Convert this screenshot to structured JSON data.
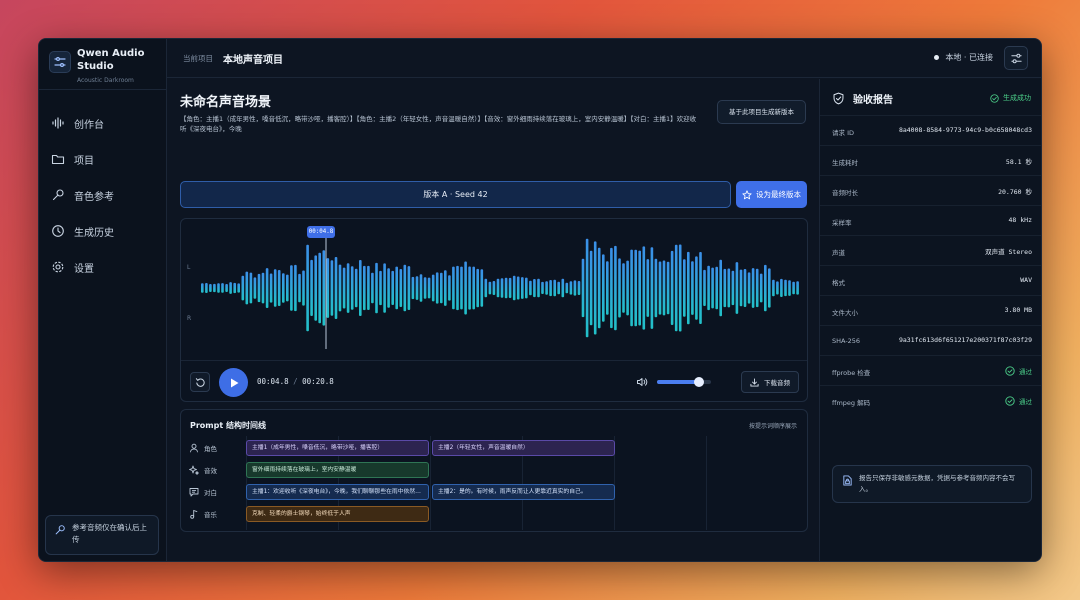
{
  "brand": {
    "name": "Qwen Audio Studio",
    "subtitle": "Acoustic Darkroom"
  },
  "nav": [
    {
      "label": "创作台",
      "icon": "waveform-icon"
    },
    {
      "label": "项目",
      "icon": "folder-icon"
    },
    {
      "label": "音色参考",
      "icon": "microphone-icon"
    },
    {
      "label": "生成历史",
      "icon": "clock-icon"
    },
    {
      "label": "设置",
      "icon": "gear-icon"
    }
  ],
  "sidebar_note": "参考音频仅在确认后上传",
  "header": {
    "crumb_label": "当前项目",
    "project_title": "本地声音项目",
    "connection": "本地 · 已连接"
  },
  "scene": {
    "title": "未命名声音场景",
    "description": "【角色：主播1（成年男性，嗓音低沉，略带沙哑，播客腔）】【角色：主播2（年轻女性，声音温暖自然）】【音效：窗外细雨持续落在玻璃上，室内安静温暖】【对白：主播1】欢迎收听《深夜电台》，今晚",
    "regen_label": "基于此项目生成新版本"
  },
  "version": {
    "label": "版本 A · Seed 42",
    "final_label": "设为最终版本"
  },
  "player": {
    "playhead": "00:04.8",
    "current": "00:04.8",
    "duration": "00:20.8",
    "separator": "/",
    "channel_left": "L",
    "channel_right": "R",
    "volume": 0.78,
    "progress": 0.23,
    "download_label": "下载音频"
  },
  "timeline": {
    "title": "Prompt 结构时间线",
    "hint": "按提示词顺序展示",
    "rows": [
      {
        "label": "角色",
        "icon": "person-icon",
        "chips": [
          {
            "text": "主播1（成年男性，嗓音低沉，略带沙哑，播客腔）",
            "kind": "role"
          },
          {
            "text": "主播2（年轻女性，声音温暖自然）",
            "kind": "role"
          }
        ]
      },
      {
        "label": "音效",
        "icon": "sparkle-icon",
        "chips": [
          {
            "text": "窗外细雨持续落在玻璃上，室内安静温暖",
            "kind": "sfx"
          }
        ]
      },
      {
        "label": "对白",
        "icon": "chat-icon",
        "chips": [
          {
            "text": "主播1：欢迎收听《深夜电台》，今晚，我们聊聊那些在雨中依然…",
            "kind": "dlg"
          },
          {
            "text": "主播2：是的。有时候，雨声反而让人更靠近真实的自己。",
            "kind": "dlg"
          }
        ]
      },
      {
        "label": "音乐",
        "icon": "music-note-icon",
        "chips": [
          {
            "text": "克制、轻柔的爵士钢琴，始终低于人声",
            "kind": "music"
          }
        ]
      }
    ]
  },
  "report": {
    "title": "验收报告",
    "status": "生成成功",
    "rows": [
      {
        "k": "请求 ID",
        "v": "8a4008-8584-9773-94c9-b0c658048cd3"
      },
      {
        "k": "生成耗时",
        "v": "58.1 秒"
      },
      {
        "k": "音频时长",
        "v": "20.760 秒"
      },
      {
        "k": "采样率",
        "v": "48 kHz"
      },
      {
        "k": "声道",
        "v": "双声道 Stereo"
      },
      {
        "k": "格式",
        "v": "WAV"
      },
      {
        "k": "文件大小",
        "v": "3.80 MB"
      },
      {
        "k": "SHA-256",
        "v": "9a31fc613d6f651217e200371f87c03f29"
      },
      {
        "k": "ffprobe 检查",
        "v": "通过",
        "ok": true
      },
      {
        "k": "ffmpeg 解码",
        "v": "通过",
        "ok": true
      }
    ],
    "note": "报告只保存非敏感元数据，凭据与参考音频内容不会写入。"
  },
  "colors": {
    "accent": "#3f6fe8",
    "success": "#4cd08a",
    "wave_top": "#3b8fe8",
    "wave_bottom": "#22c1c8"
  }
}
